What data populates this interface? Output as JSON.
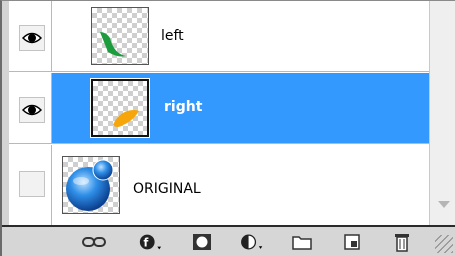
{
  "layers": [
    {
      "name": "left",
      "visible": true,
      "selected": false,
      "thumb_icon": "green-shape-icon"
    },
    {
      "name": "right",
      "visible": true,
      "selected": true,
      "thumb_icon": "orange-shape-icon"
    },
    {
      "name": "ORIGINAL",
      "visible": false,
      "selected": false,
      "thumb_icon": "blue-sphere-icon"
    }
  ],
  "toolbar": {
    "buttons": [
      "link-layers-icon",
      "layer-style-icon",
      "layer-mask-icon",
      "adjustment-layer-icon",
      "new-group-icon",
      "new-layer-icon",
      "delete-layer-icon"
    ]
  },
  "colors": {
    "selection": "#3399ff",
    "green_shape": "#1c9c3c",
    "orange_shape": "#f6a50a",
    "blue_sphere": "#1b78d6"
  }
}
